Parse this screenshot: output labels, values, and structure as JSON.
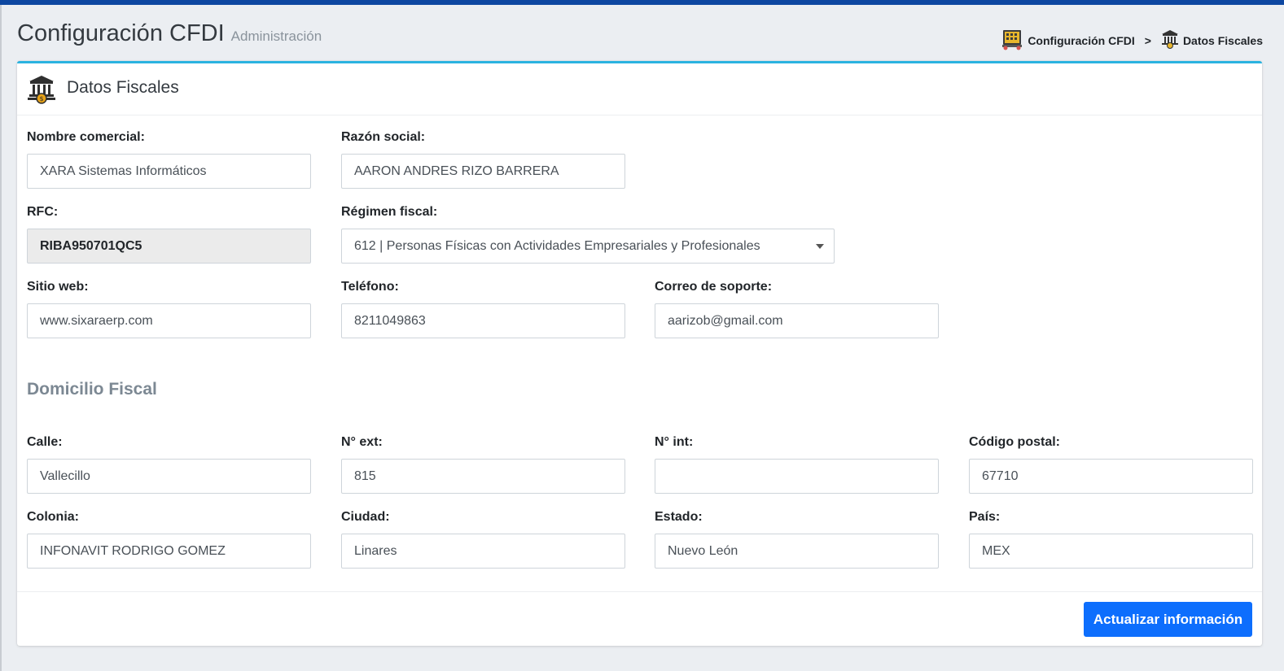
{
  "header": {
    "title": "Configuración CFDI",
    "subtitle": "Administración"
  },
  "breadcrumb": {
    "items": [
      {
        "label": "Configuración CFDI",
        "icon": "building-config-icon"
      },
      {
        "label": "Datos Fiscales",
        "icon": "bank-icon"
      }
    ],
    "separator": ">"
  },
  "card": {
    "title": "Datos Fiscales",
    "icon": "bank-money-icon",
    "accent_color": "#2bb3e0"
  },
  "form": {
    "nombre_comercial": {
      "label": "Nombre comercial:",
      "value": "XARA Sistemas Informáticos"
    },
    "razon_social": {
      "label": "Razón social:",
      "value": "AARON ANDRES RIZO BARRERA"
    },
    "rfc": {
      "label": "RFC:",
      "value": "RIBA950701QC5"
    },
    "regimen_fiscal": {
      "label": "Régimen fiscal:",
      "value": "612 | Personas Físicas con Actividades Empresariales y Profesionales"
    },
    "sitio_web": {
      "label": "Sitio web:",
      "value": "www.sixaraerp.com"
    },
    "telefono": {
      "label": "Teléfono:",
      "value": "8211049863"
    },
    "correo_soporte": {
      "label": "Correo de soporte:",
      "value": "aarizob@gmail.com"
    }
  },
  "domicilio": {
    "section_title": "Domicilio Fiscal",
    "calle": {
      "label": "Calle:",
      "value": "Vallecillo"
    },
    "num_ext": {
      "label": "N° ext:",
      "value": "815"
    },
    "num_int": {
      "label": "N° int:",
      "value": ""
    },
    "codigo_postal": {
      "label": "Código postal:",
      "value": "67710"
    },
    "colonia": {
      "label": "Colonia:",
      "value": "INFONAVIT RODRIGO GOMEZ"
    },
    "ciudad": {
      "label": "Ciudad:",
      "value": "Linares"
    },
    "estado": {
      "label": "Estado:",
      "value": "Nuevo León"
    },
    "pais": {
      "label": "País:",
      "value": "MEX"
    }
  },
  "footer": {
    "submit_label": "Actualizar información",
    "submit_color": "#0d6efd"
  }
}
